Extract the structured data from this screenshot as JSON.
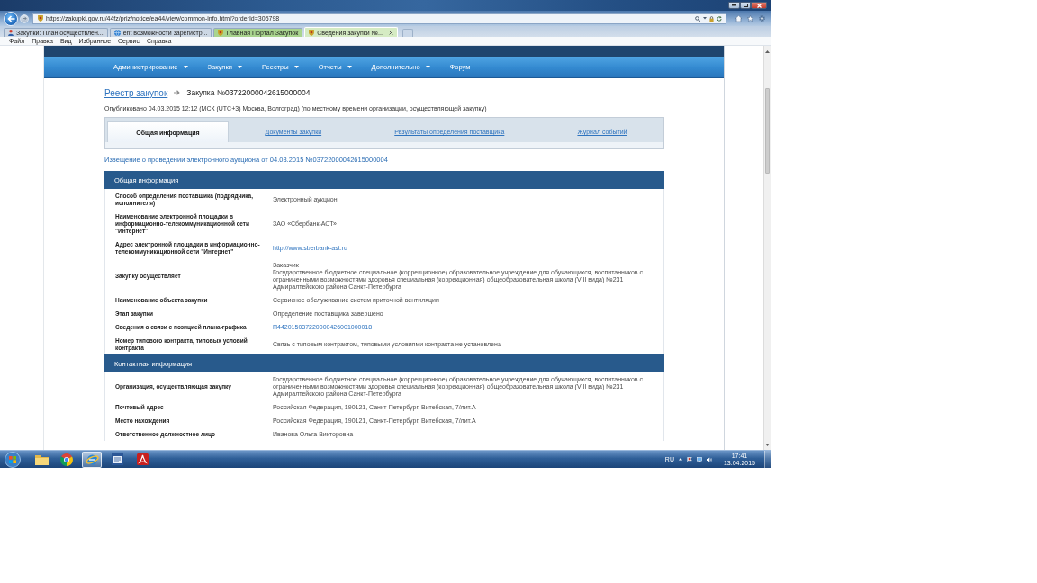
{
  "browser": {
    "address": "https://zakupki.gov.ru/44fz/priz/notice/ea44/view/common-info.html?orderId=305798",
    "tabs": [
      {
        "label": "Закупки: План осуществлен...",
        "kind": "person",
        "color": "#ccd7e4",
        "selected": false
      },
      {
        "label": "ent возможности зарегистр...",
        "kind": "globe",
        "color": "#ccd7e4",
        "selected": false
      },
      {
        "label": "Главная Портал Закупок",
        "kind": "emblem",
        "color": "#a9d48e",
        "selected": false
      },
      {
        "label": "Сведения закупки №...",
        "kind": "emblem",
        "color": "#d5ebc3",
        "selected": true
      }
    ],
    "menu": [
      "Файл",
      "Правка",
      "Вид",
      "Избранное",
      "Сервис",
      "Справка"
    ]
  },
  "nav": [
    {
      "label": "Администрирование",
      "dropdown": true
    },
    {
      "label": "Закупки",
      "dropdown": true
    },
    {
      "label": "Реестры",
      "dropdown": true
    },
    {
      "label": "Отчеты",
      "dropdown": true
    },
    {
      "label": "Дополнительно",
      "dropdown": true
    },
    {
      "label": "Форум",
      "dropdown": false
    }
  ],
  "breadcrumb": {
    "link": "Реестр закупок",
    "current": "Закупка №03722000042615000004"
  },
  "published": "Опубликовано 04.03.2015 12:12 (МСК (UTC+3) Москва, Волгоград) (по местному времени организации, осуществляющей закупку)",
  "tabs": [
    {
      "label": "Общая информация",
      "selected": true
    },
    {
      "label": "Документы закупки",
      "selected": false
    },
    {
      "label": "Результаты определения поставщика",
      "selected": false
    },
    {
      "label": "Журнал событий",
      "selected": false
    }
  ],
  "notice_title": "Извещение о проведении электронного аукциона от 04.03.2015 №03722000042615000004",
  "sections": [
    {
      "title": "Общая информация",
      "rows": [
        {
          "label": "Способ определения поставщика (подрядчика, исполнителя)",
          "kind": "text",
          "values": [
            "Электронный аукцион"
          ]
        },
        {
          "label": "Наименование электронной площадки в информационно-телекоммуникационной сети \"Интернет\"",
          "kind": "text",
          "values": [
            "ЗАО «Сбербанк-АСТ»"
          ]
        },
        {
          "label": "Адрес электронной площадки в информационно-телекоммуникационной сети \"Интернет\"",
          "kind": "link",
          "values": [
            "http://www.sberbank-ast.ru"
          ]
        },
        {
          "label": "Закупку осуществляет",
          "kind": "text",
          "values": [
            "Заказчик",
            "Государственное бюджетное специальное (коррекционное) образовательное учреждение для обучающихся, воспитанников с ограниченными возможностями здоровья специальная (коррекционная) общеобразовательная школа (VIII вида) №231 Адмиралтейского района Санкт-Петербурга"
          ]
        },
        {
          "label": "Наименование объекта закупки",
          "kind": "text",
          "values": [
            "Сервисное обслуживание систем приточной вентиляции"
          ]
        },
        {
          "label": "Этап закупки",
          "kind": "text",
          "values": [
            "Определение поставщика завершено"
          ]
        },
        {
          "label": "Сведения о связи с позицией плана-графика",
          "kind": "link",
          "values": [
            "П442015037220000426001000018"
          ]
        },
        {
          "label": "Номер типового контракта, типовых условий контракта",
          "kind": "text",
          "values": [
            "Связь с типовым контрактом, типовыми условиями контракта не установлена"
          ]
        }
      ]
    },
    {
      "title": "Контактная информация",
      "rows": [
        {
          "label": "Организация, осуществляющая закупку",
          "kind": "text",
          "values": [
            "Государственное бюджетное специальное (коррекционное) образовательное учреждение для обучающихся, воспитанников с ограниченными возможностями здоровья специальная (коррекционная) общеобразовательная школа (VIII вида) №231 Адмиралтейского района Санкт-Петербурга"
          ]
        },
        {
          "label": "Почтовый адрес",
          "kind": "text",
          "values": [
            "Российская Федерация, 190121, Санкт-Петербург, Витебская, 7/лит.А"
          ]
        },
        {
          "label": "Место нахождения",
          "kind": "text",
          "values": [
            "Российская Федерация, 190121, Санкт-Петербург, Витебская, 7/лит.А"
          ]
        },
        {
          "label": "Ответственное должностное лицо",
          "kind": "text",
          "values": [
            "Иванова Ольга Викторовна"
          ]
        }
      ]
    }
  ],
  "taskbar": {
    "apps": [
      {
        "kind": "folder",
        "selected": false
      },
      {
        "kind": "tricolor",
        "selected": false
      },
      {
        "kind": "orbit",
        "selected": true
      },
      {
        "kind": "window",
        "selected": false
      },
      {
        "kind": "ribbon",
        "selected": false
      }
    ],
    "language": "RU",
    "time": "17:41",
    "date": "13.04.2015"
  }
}
